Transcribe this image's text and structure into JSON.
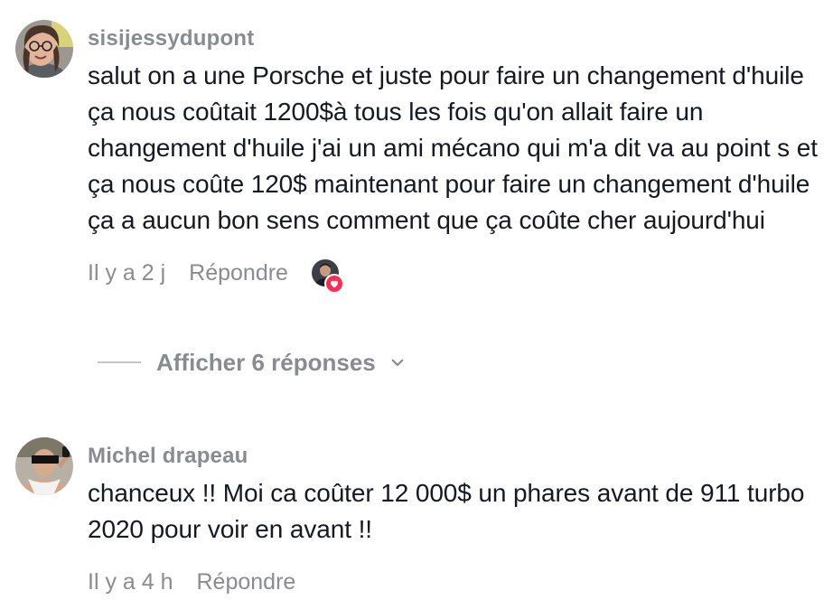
{
  "comments": [
    {
      "username": "sisijessydupont",
      "text": "salut on a une Porsche et juste pour faire un changement d'huile ça nous coûtait 1200$à tous les fois qu'on allait faire un changement d'huile j'ai un ami mécano qui m'a dit va au point s et ça nous coûte 120$ maintenant pour faire un changement d'huile ça a aucun bon sens comment que ça coûte cher aujourd'hui",
      "time": "Il y a 2 j",
      "reply_label": "Répondre"
    },
    {
      "username": "Michel drapeau",
      "text": "chanceux !! Moi ca coûter 12 000$ un phares avant de 911 turbo 2020 pour voir en avant !!",
      "time": "Il y a 4 h",
      "reply_label": "Répondre"
    }
  ],
  "show_replies_label": "Afficher 6 réponses",
  "colors": {
    "text": "#161823",
    "muted": "#8a8b91",
    "heart": "#fe2c55"
  },
  "icons": {
    "liked_by_creator": "heart-icon",
    "expand": "chevron-down-icon"
  }
}
